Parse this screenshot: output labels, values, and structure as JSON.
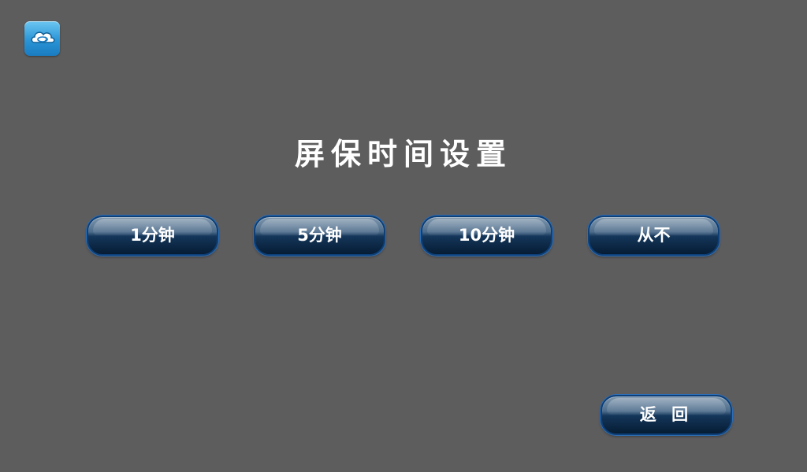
{
  "app": {
    "icon": "cloud-sync-icon"
  },
  "page": {
    "title": "屏保时间设置"
  },
  "options": [
    {
      "label": "1分钟"
    },
    {
      "label": "5分钟"
    },
    {
      "label": "10分钟"
    },
    {
      "label": "从不"
    }
  ],
  "footer": {
    "back_label": "返 回"
  },
  "colors": {
    "background": "#5e5d5e",
    "button_dark": "#061c33",
    "button_border": "#0d3f78",
    "icon_blue": "#2a95d6",
    "text": "#ffffff"
  }
}
